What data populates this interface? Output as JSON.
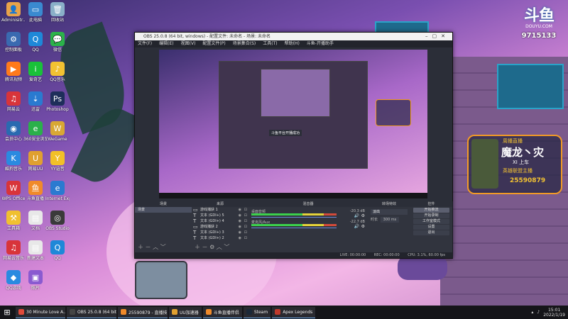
{
  "desktop": {
    "icons": [
      {
        "label": "Adminisitr...",
        "color": "#e8a34a",
        "glyph": "👤"
      },
      {
        "label": "此电脑",
        "color": "#3a8ad0",
        "glyph": "▭"
      },
      {
        "label": "回收站",
        "color": "#8ab0c8",
        "glyph": "🗑"
      },
      {
        "label": "控制面板",
        "color": "#3a6ab0",
        "glyph": "⚙"
      },
      {
        "label": "QQ",
        "color": "#1e88d8",
        "glyph": "Q"
      },
      {
        "label": "微信",
        "color": "#2bb34a",
        "glyph": "💬"
      },
      {
        "label": "腾讯视频",
        "color": "#ff7a1a",
        "glyph": "▶"
      },
      {
        "label": "爱奇艺",
        "color": "#19c139",
        "glyph": "i"
      },
      {
        "label": "QQ音乐",
        "color": "#f2c232",
        "glyph": "♪"
      },
      {
        "label": "网易云",
        "color": "#d8343a",
        "glyph": "♫"
      },
      {
        "label": "迅雷",
        "color": "#2a7ad0",
        "glyph": "⇣"
      },
      {
        "label": "Photoshop",
        "color": "#1e2e5a",
        "glyph": "Ps"
      },
      {
        "label": "会员中心",
        "color": "#2a6ab0",
        "glyph": "◉"
      },
      {
        "label": "360安全浏览器",
        "color": "#2ab04a",
        "glyph": "e"
      },
      {
        "label": "WeGame",
        "color": "#d8a834",
        "glyph": "W"
      },
      {
        "label": "酷狗音乐",
        "color": "#2a8ae0",
        "glyph": "K"
      },
      {
        "label": "网易UU",
        "color": "#e0a030",
        "glyph": "U"
      },
      {
        "label": "YY语音",
        "color": "#f2c028",
        "glyph": "Y"
      },
      {
        "label": "WPS Office",
        "color": "#d8343a",
        "glyph": "W"
      },
      {
        "label": "斗鱼直播",
        "color": "#f08a2a",
        "glyph": "鱼"
      },
      {
        "label": "Internet Explorer",
        "color": "#2a7ad0",
        "glyph": "e"
      },
      {
        "label": "工具箱",
        "color": "#f0c030",
        "glyph": "⚒"
      },
      {
        "label": "文档",
        "color": "#e8e8e8",
        "glyph": "▤"
      },
      {
        "label": "OBS Studio",
        "color": "#3a3a3a",
        "glyph": "◎"
      },
      {
        "label": "网易云音乐",
        "color": "#d8343a",
        "glyph": "♫"
      },
      {
        "label": "新建文本",
        "color": "#e8e8e8",
        "glyph": "▤"
      },
      {
        "label": "QQ",
        "color": "#1e88d8",
        "glyph": "Q"
      },
      {
        "label": "QQ游戏",
        "color": "#2a8ae0",
        "glyph": "◆"
      },
      {
        "label": "照片",
        "color": "#8a5ad0",
        "glyph": "▣"
      }
    ]
  },
  "douyu": {
    "logo": "斗鱼",
    "url": "DOUYU.COM",
    "room_id": "9715133"
  },
  "streamer_badge": {
    "top_label": "周播直播",
    "name": "魔龙丶灾",
    "sub": "XI 上车",
    "line": "英雄联盟主播",
    "id": "25590879"
  },
  "obs": {
    "title": "OBS 25.0.8 (64 bit, windows) - 配置文件: 未命名 - 场景: 未命名",
    "menu": [
      "文件(F)",
      "编辑(E)",
      "视图(V)",
      "配置文件(P)",
      "场景集合(S)",
      "工具(T)",
      "帮助(H)",
      "斗鱼-开播助手"
    ],
    "panel_titles": {
      "scenes": "场景",
      "sources": "来源",
      "mixer": "混音器",
      "transitions": "转场特效",
      "controls": "控件"
    },
    "scenes": [
      "场景"
    ],
    "sources": [
      "游戏捕获 1",
      "文本 (GDI+) 5",
      "文本 (GDI+) 4",
      "游戏捕获 2",
      "文本 (GDI+) 3",
      "文本 (GDI+) 2"
    ],
    "mixer": [
      {
        "label": "桌面音频",
        "db": "-20.3 dB"
      },
      {
        "label": "麦克风/Aux",
        "db": "-22.7 dB"
      }
    ],
    "transition": {
      "type": "淡出",
      "duration_label": "时长",
      "duration": "300 ms"
    },
    "controls": [
      "开始推流",
      "开始录制",
      "工作室模式",
      "设置",
      "退出"
    ],
    "status": {
      "live": "LIVE: 00:00:00",
      "rec": "REC: 00:00:00",
      "cpu": "CPU: 3.1%, 60.00 fps"
    },
    "nested_dialog": "斗鱼平台开播成功"
  },
  "taskbar": {
    "items": [
      {
        "label": "30 Minute Love A...",
        "color": "#e04a3a"
      },
      {
        "label": "OBS 25.0.8 (64 bit)...",
        "color": "#444"
      },
      {
        "label": "25590879 - 直播技...",
        "color": "#f08a2a"
      },
      {
        "label": "UU加速器",
        "color": "#e0a030"
      },
      {
        "label": "斗鱼直播伴侣",
        "color": "#f08a2a"
      },
      {
        "label": "Steam",
        "color": "#1b2838"
      },
      {
        "label": "Apex Legends",
        "color": "#c0392b"
      }
    ],
    "time": "15:01",
    "date": "2022/1/19"
  }
}
